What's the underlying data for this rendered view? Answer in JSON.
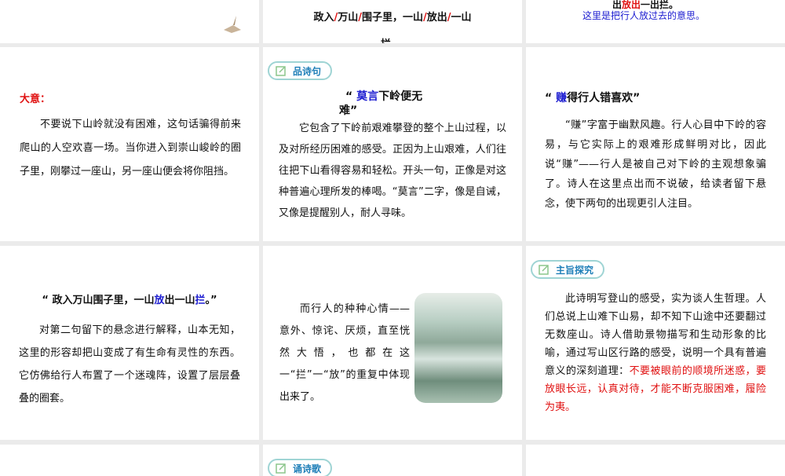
{
  "top_middle": {
    "text_parts": [
      "政入",
      "/",
      "万山",
      "/",
      "围子里，一山",
      "/",
      "放出",
      "/",
      "一山"
    ],
    "cut_line": "拦。"
  },
  "top_right": {
    "cut_line_parts": [
      "出",
      "放出",
      "一出拦。"
    ],
    "note": "这里是把行人放过去的意思。"
  },
  "cell_meaning": {
    "label": "大意：",
    "text": "不要说下山岭就没有困难，这句话骗得前来爬山的人空欢喜一场。当你进入到崇山峻岭的圈子里，刚攀过一座山，另一座山便会将你阻挡。"
  },
  "cell_mo_yan": {
    "badge": "品诗句",
    "title_open": "“ ",
    "title_highlight": "莫言",
    "title_rest": "下岭便无",
    "title_line2": "难”",
    "text": "它包含了下岭前艰难攀登的整个上山过程，以及对所经历困难的感受。正因为上山艰难，人们往往把下山看得容易和轻松。开头一句，正像是对这种普遍心理所发的棒喝。“莫言”二字，像是自诫，又像是提醒别人，耐人寻味。"
  },
  "cell_zhuan": {
    "title_open": "“ ",
    "title_highlight": "赚",
    "title_rest": "得行人错喜欢”",
    "text": "“赚”字富于幽默风趣。行人心目中下岭的容易，与它实际上的艰难形成鲜明对比，因此说“赚”——行人是被自己对下岭的主观想象骗了。诗人在这里点出而不说破，给读者留下悬念，使下两句的出现更引人注目。"
  },
  "cell_zheng_ru": {
    "title_a": "“ 政入万山围子里，一山",
    "title_hl1": "放",
    "title_b": "出一山",
    "title_hl2": "拦",
    "title_c": "。”",
    "text": "对第二句留下的悬念进行解释，山本无知，这里的形容却把山变成了有生命有灵性的东西。它仿佛给行人布置了一个迷魂阵，设置了层层叠叠的圈套。"
  },
  "cell_xinqing": {
    "text": "而行人的种种心情——意外、惊诧、厌烦，直至恍然大悟，也都在这一“拦”一“放”的重复中体现出来了。"
  },
  "cell_theme": {
    "badge": "主旨探究",
    "text": "此诗明写登山的感受，实为谈人生哲理。人们总说上山难下山易，却不知下山途中还要翻过无数座山。诗人借助景物描写和生动形象的比喻，通过写山区行路的感受，说明一个具有普遍意义的深刻道理：",
    "highlight": "不要被眼前的顺境所迷惑，要放眼长远，认真对待，才能不断克服困难，履险为夷。"
  },
  "bottom_middle": {
    "badge": "诵诗歌"
  }
}
